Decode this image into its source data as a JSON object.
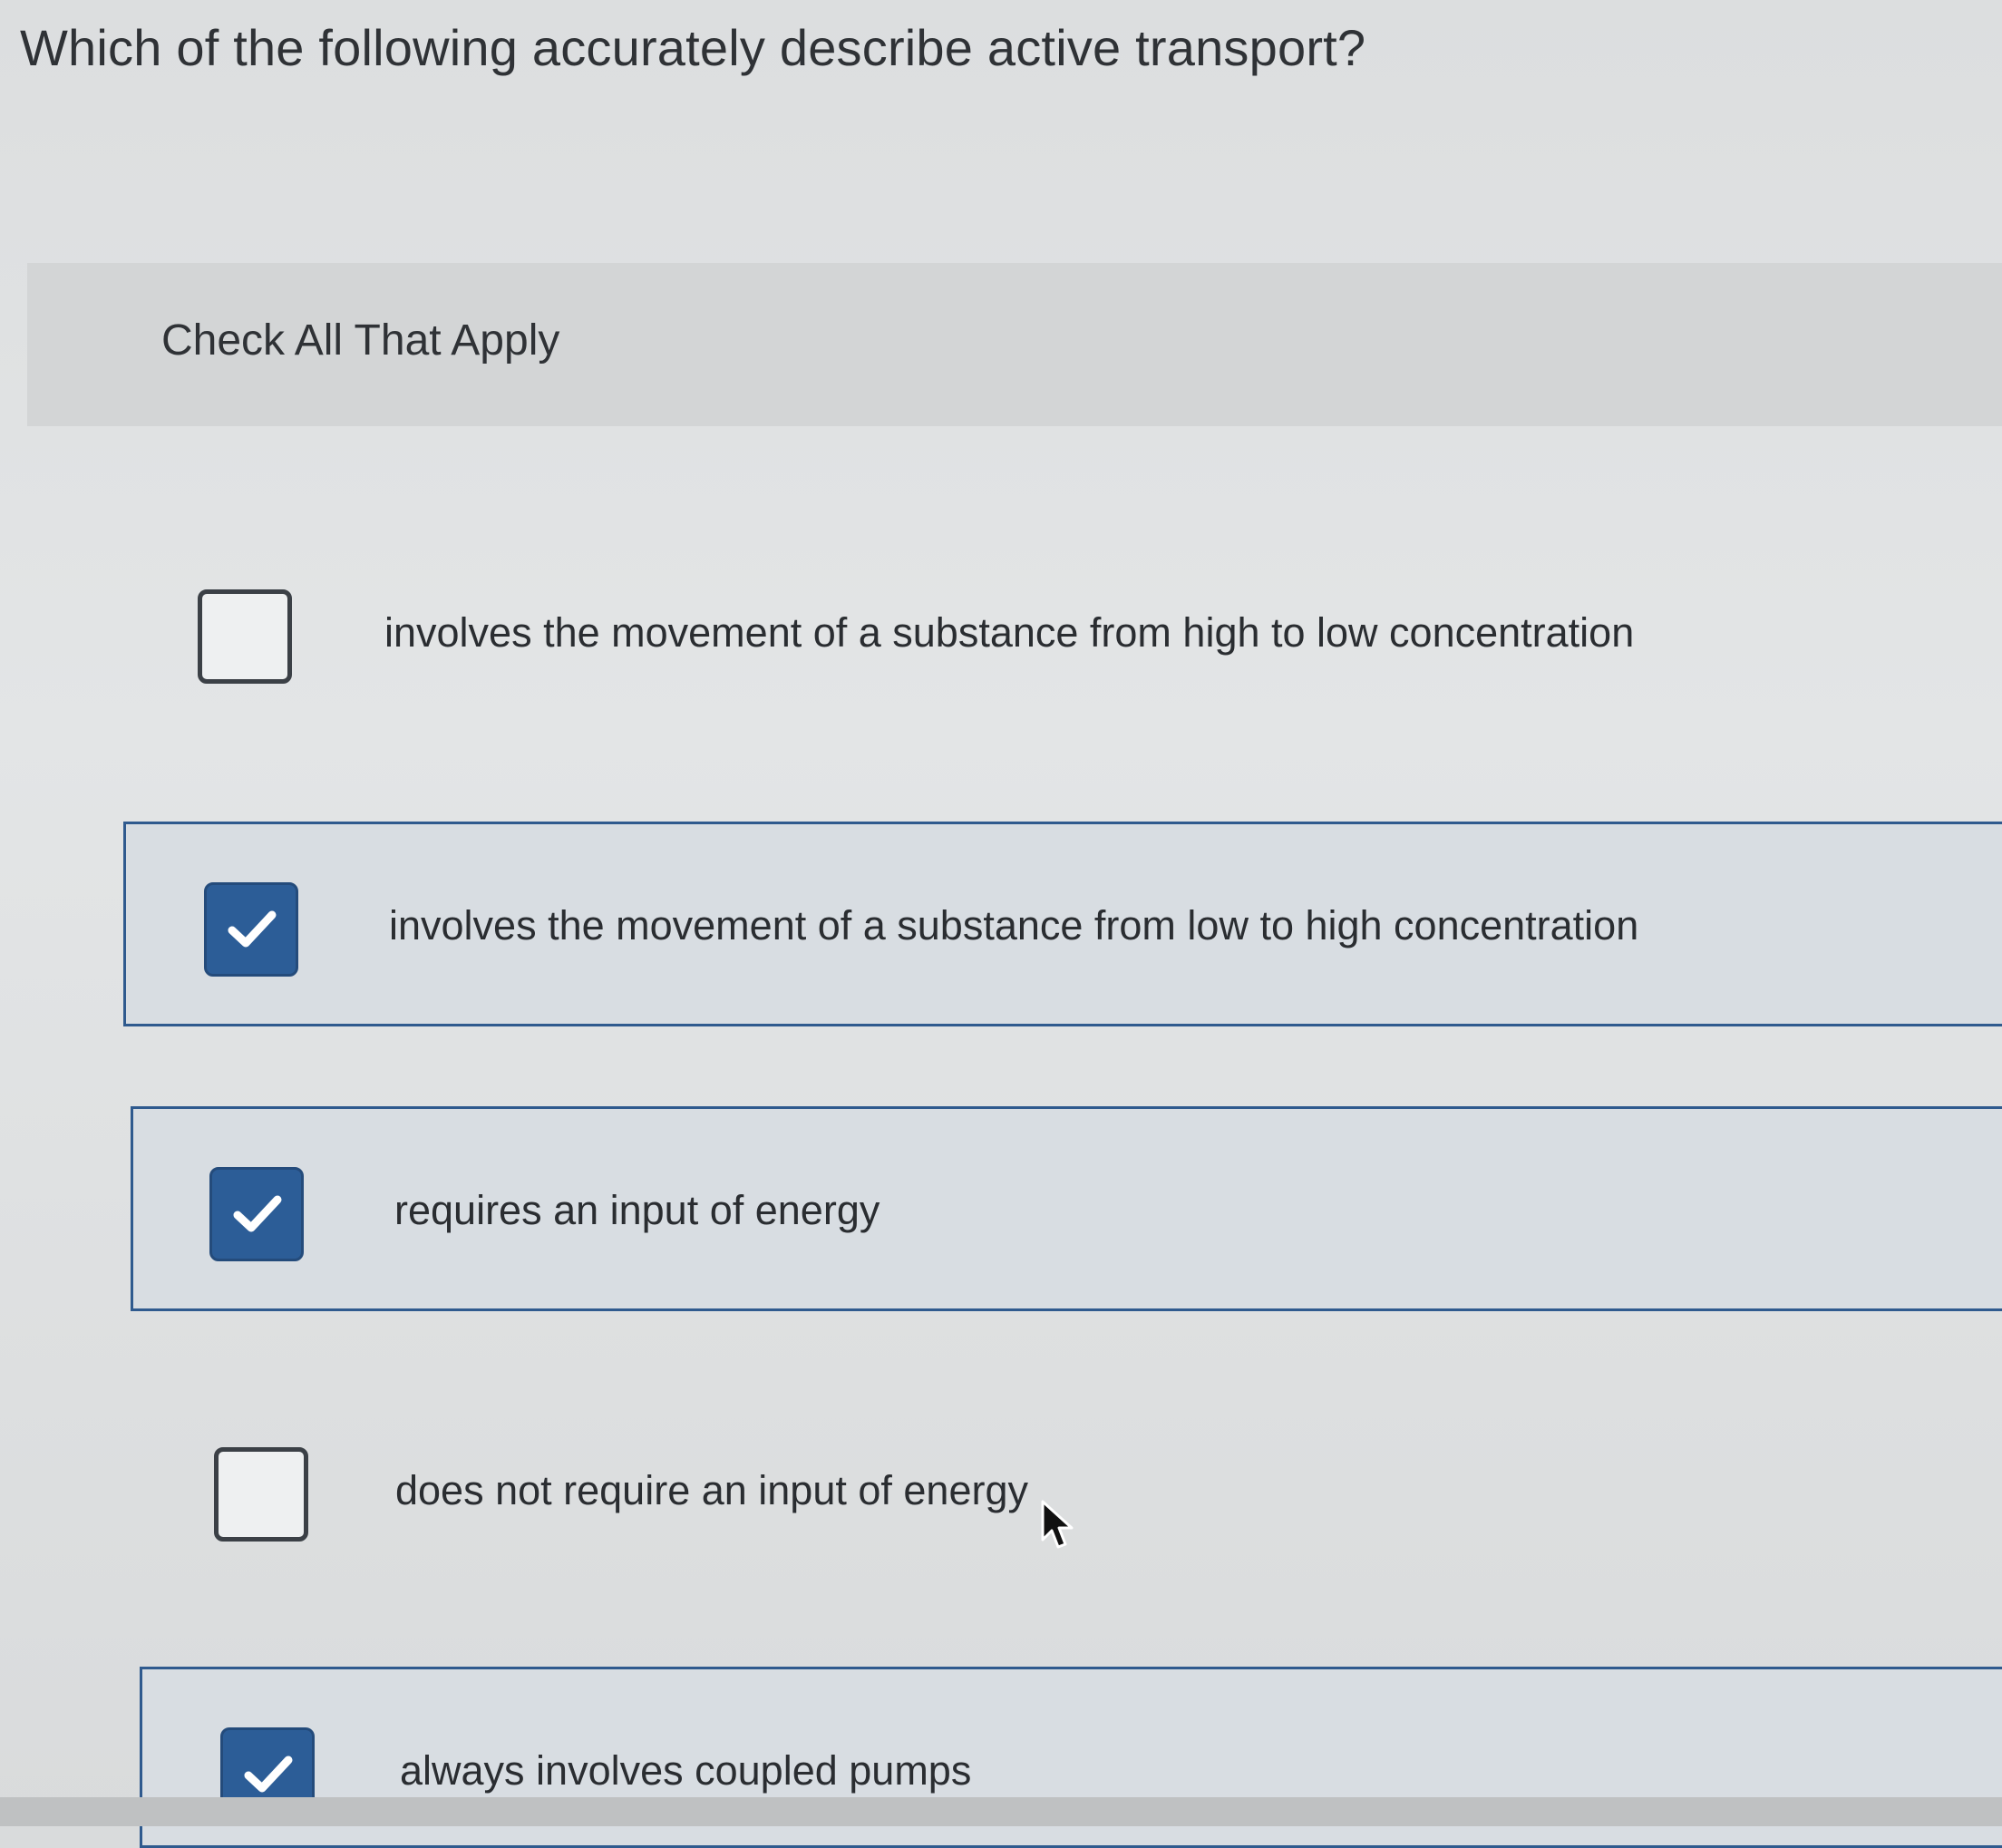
{
  "question": {
    "text": "Which of the following accurately describe active transport?"
  },
  "instructions": "Check All That Apply",
  "options": [
    {
      "label": "involves the movement of a substance from high to low concentration",
      "checked": false
    },
    {
      "label": "involves the movement of a substance from low to high concentration",
      "checked": true
    },
    {
      "label": "requires an input of energy",
      "checked": true
    },
    {
      "label": "does not require an input of energy",
      "checked": false
    },
    {
      "label": "always involves coupled pumps",
      "checked": true
    }
  ],
  "colors": {
    "accent": "#2c5d97",
    "text": "#2f3236",
    "selected_background": "#d8dde2"
  }
}
